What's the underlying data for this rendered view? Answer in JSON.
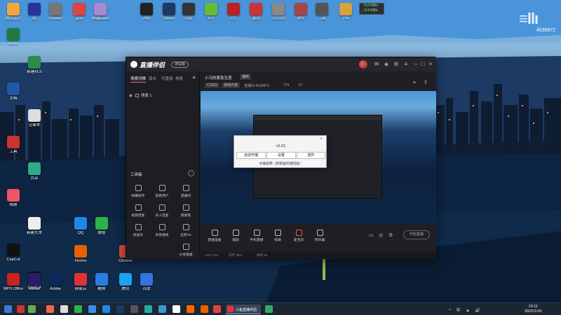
{
  "desktop": {
    "top_icons": [
      {
        "label": "腾讯会议",
        "color": "#f2a83b"
      },
      {
        "label": "SE",
        "color": "#26339a"
      },
      {
        "label": "vmware",
        "color": "#777"
      },
      {
        "label": "gvm",
        "color": "#d44"
      },
      {
        "label": "Wallpaper",
        "color": "#a8c"
      },
      {
        "label": "钟表",
        "color": "#222"
      },
      {
        "label": "Steam",
        "color": "#1e3a5f"
      },
      {
        "label": "风扇",
        "color": "#333"
      },
      {
        "label": "TOT",
        "color": "#6b3"
      },
      {
        "label": "CS",
        "color": "#b22"
      },
      {
        "label": "游戏",
        "color": "#c33"
      },
      {
        "label": "CS:GO",
        "color": "#888"
      },
      {
        "label": "赛车",
        "color": "#a44"
      },
      {
        "label": "工具",
        "color": "#555"
      },
      {
        "label": "TM",
        "color": "#d8a040"
      }
    ],
    "left_icons": [
      {
        "label": "Excel",
        "color": "#1f7a3e"
      },
      {
        "label": "新建XLS",
        "color": "#2a8b4b"
      },
      {
        "label": "文档",
        "color": "#1e5aa8"
      },
      {
        "label": "记事本",
        "color": "#ddd"
      },
      {
        "label": "工具",
        "color": "#c33"
      },
      {
        "label": "共享",
        "color": "#3a8"
      },
      {
        "label": "相册",
        "color": "#e56"
      },
      {
        "label": "新建文本",
        "color": "#eee"
      },
      {
        "label": "CapCut",
        "color": "#111"
      },
      {
        "label": "CapCut",
        "color": "#111"
      },
      {
        "label": "WPS Office",
        "color": "#c22"
      }
    ],
    "bottom_icons": [
      {
        "label": "Adobe",
        "color": "#2b1b6b"
      },
      {
        "label": "Adobe",
        "color": "#0b2a5a"
      },
      {
        "label": "QQ",
        "color": "#1e88e5"
      },
      {
        "label": "微信",
        "color": "#2cb34a"
      },
      {
        "label": "Firefox",
        "color": "#e66000"
      },
      {
        "label": "Chrome",
        "color": "#dd4b39"
      },
      {
        "label": "网易云",
        "color": "#d33"
      },
      {
        "label": "酷狗",
        "color": "#2c7be5"
      },
      {
        "label": "腾讯",
        "color": "#1da1f2"
      },
      {
        "label": "百度",
        "color": "#3971e0"
      }
    ],
    "net_up": "↑ 5.0 KB/s",
    "net_down": "↓ 5.9 KB/s",
    "live_id": "4536872"
  },
  "app": {
    "logo_text": "直播伴侣",
    "beta_label": "测试版",
    "left_tabs": [
      "场景切换",
      "双击",
      "可直接",
      "场景"
    ],
    "scene_name": "场景 1",
    "tools_header": "工具箱",
    "tools": [
      {
        "label": "弹幕助手"
      },
      {
        "label": "观看用户"
      },
      {
        "label": "直播间"
      },
      {
        "label": "视频连麦"
      },
      {
        "label": "多人连麦"
      },
      {
        "label": "摸摸等"
      },
      {
        "label": "绘画鸟"
      },
      {
        "label": "背景替换"
      },
      {
        "label": "全民PK"
      },
      {
        "label": "分身直播"
      }
    ],
    "room_title": "小马的紧急生涯",
    "room_edit": "编辑",
    "game_tag": "CSGO",
    "game_tag2": "游戏内容",
    "room_id": "直播ID:4536872",
    "fans": "774",
    "viewers": "57",
    "dialog": {
      "title": "v1.01",
      "buttons": [
        "自动开播",
        "设置",
        "插件"
      ],
      "link": "点播说明（如有疑问请回复）"
    },
    "bottom_tools": [
      {
        "label": "直播准备"
      },
      {
        "label": "美颜"
      },
      {
        "label": "手机直播"
      },
      {
        "label": "投屏"
      },
      {
        "label": "麦克风"
      },
      {
        "label": "扬声器"
      }
    ],
    "start_live": "开始直播",
    "status": [
      "CPU 16%",
      "内存 35%",
      "帧率 60"
    ]
  },
  "taskbar": {
    "active_title": "斗鱼直播伴侣",
    "time": "19:11",
    "date": "2022/1/10",
    "tray": "^ 中 ▲ 🔊"
  }
}
